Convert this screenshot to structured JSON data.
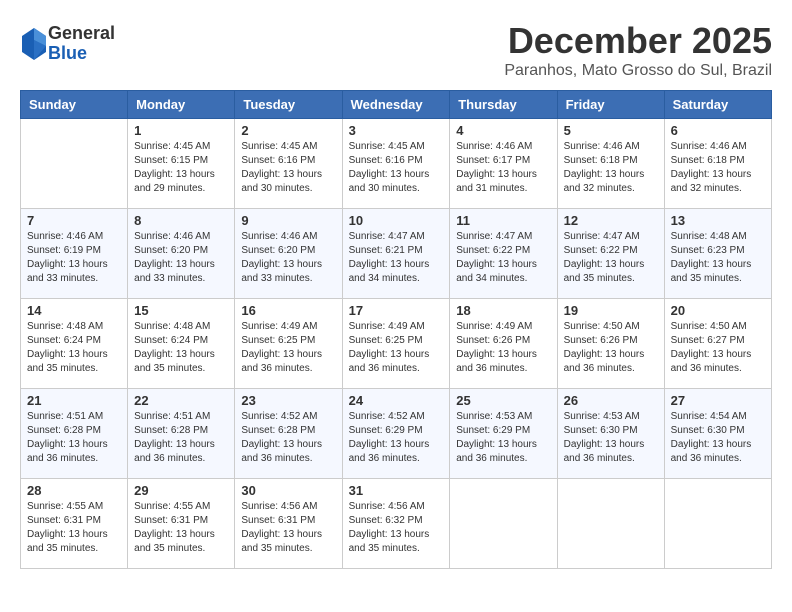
{
  "logo": {
    "general": "General",
    "blue": "Blue"
  },
  "header": {
    "month": "December 2025",
    "location": "Paranhos, Mato Grosso do Sul, Brazil"
  },
  "days_of_week": [
    "Sunday",
    "Monday",
    "Tuesday",
    "Wednesday",
    "Thursday",
    "Friday",
    "Saturday"
  ],
  "weeks": [
    [
      {
        "day": "",
        "info": ""
      },
      {
        "day": "1",
        "info": "Sunrise: 4:45 AM\nSunset: 6:15 PM\nDaylight: 13 hours\nand 29 minutes."
      },
      {
        "day": "2",
        "info": "Sunrise: 4:45 AM\nSunset: 6:16 PM\nDaylight: 13 hours\nand 30 minutes."
      },
      {
        "day": "3",
        "info": "Sunrise: 4:45 AM\nSunset: 6:16 PM\nDaylight: 13 hours\nand 30 minutes."
      },
      {
        "day": "4",
        "info": "Sunrise: 4:46 AM\nSunset: 6:17 PM\nDaylight: 13 hours\nand 31 minutes."
      },
      {
        "day": "5",
        "info": "Sunrise: 4:46 AM\nSunset: 6:18 PM\nDaylight: 13 hours\nand 32 minutes."
      },
      {
        "day": "6",
        "info": "Sunrise: 4:46 AM\nSunset: 6:18 PM\nDaylight: 13 hours\nand 32 minutes."
      }
    ],
    [
      {
        "day": "7",
        "info": "Sunrise: 4:46 AM\nSunset: 6:19 PM\nDaylight: 13 hours\nand 33 minutes."
      },
      {
        "day": "8",
        "info": "Sunrise: 4:46 AM\nSunset: 6:20 PM\nDaylight: 13 hours\nand 33 minutes."
      },
      {
        "day": "9",
        "info": "Sunrise: 4:46 AM\nSunset: 6:20 PM\nDaylight: 13 hours\nand 33 minutes."
      },
      {
        "day": "10",
        "info": "Sunrise: 4:47 AM\nSunset: 6:21 PM\nDaylight: 13 hours\nand 34 minutes."
      },
      {
        "day": "11",
        "info": "Sunrise: 4:47 AM\nSunset: 6:22 PM\nDaylight: 13 hours\nand 34 minutes."
      },
      {
        "day": "12",
        "info": "Sunrise: 4:47 AM\nSunset: 6:22 PM\nDaylight: 13 hours\nand 35 minutes."
      },
      {
        "day": "13",
        "info": "Sunrise: 4:48 AM\nSunset: 6:23 PM\nDaylight: 13 hours\nand 35 minutes."
      }
    ],
    [
      {
        "day": "14",
        "info": "Sunrise: 4:48 AM\nSunset: 6:24 PM\nDaylight: 13 hours\nand 35 minutes."
      },
      {
        "day": "15",
        "info": "Sunrise: 4:48 AM\nSunset: 6:24 PM\nDaylight: 13 hours\nand 35 minutes."
      },
      {
        "day": "16",
        "info": "Sunrise: 4:49 AM\nSunset: 6:25 PM\nDaylight: 13 hours\nand 36 minutes."
      },
      {
        "day": "17",
        "info": "Sunrise: 4:49 AM\nSunset: 6:25 PM\nDaylight: 13 hours\nand 36 minutes."
      },
      {
        "day": "18",
        "info": "Sunrise: 4:49 AM\nSunset: 6:26 PM\nDaylight: 13 hours\nand 36 minutes."
      },
      {
        "day": "19",
        "info": "Sunrise: 4:50 AM\nSunset: 6:26 PM\nDaylight: 13 hours\nand 36 minutes."
      },
      {
        "day": "20",
        "info": "Sunrise: 4:50 AM\nSunset: 6:27 PM\nDaylight: 13 hours\nand 36 minutes."
      }
    ],
    [
      {
        "day": "21",
        "info": "Sunrise: 4:51 AM\nSunset: 6:28 PM\nDaylight: 13 hours\nand 36 minutes."
      },
      {
        "day": "22",
        "info": "Sunrise: 4:51 AM\nSunset: 6:28 PM\nDaylight: 13 hours\nand 36 minutes."
      },
      {
        "day": "23",
        "info": "Sunrise: 4:52 AM\nSunset: 6:28 PM\nDaylight: 13 hours\nand 36 minutes."
      },
      {
        "day": "24",
        "info": "Sunrise: 4:52 AM\nSunset: 6:29 PM\nDaylight: 13 hours\nand 36 minutes."
      },
      {
        "day": "25",
        "info": "Sunrise: 4:53 AM\nSunset: 6:29 PM\nDaylight: 13 hours\nand 36 minutes."
      },
      {
        "day": "26",
        "info": "Sunrise: 4:53 AM\nSunset: 6:30 PM\nDaylight: 13 hours\nand 36 minutes."
      },
      {
        "day": "27",
        "info": "Sunrise: 4:54 AM\nSunset: 6:30 PM\nDaylight: 13 hours\nand 36 minutes."
      }
    ],
    [
      {
        "day": "28",
        "info": "Sunrise: 4:55 AM\nSunset: 6:31 PM\nDaylight: 13 hours\nand 35 minutes."
      },
      {
        "day": "29",
        "info": "Sunrise: 4:55 AM\nSunset: 6:31 PM\nDaylight: 13 hours\nand 35 minutes."
      },
      {
        "day": "30",
        "info": "Sunrise: 4:56 AM\nSunset: 6:31 PM\nDaylight: 13 hours\nand 35 minutes."
      },
      {
        "day": "31",
        "info": "Sunrise: 4:56 AM\nSunset: 6:32 PM\nDaylight: 13 hours\nand 35 minutes."
      },
      {
        "day": "",
        "info": ""
      },
      {
        "day": "",
        "info": ""
      },
      {
        "day": "",
        "info": ""
      }
    ]
  ]
}
